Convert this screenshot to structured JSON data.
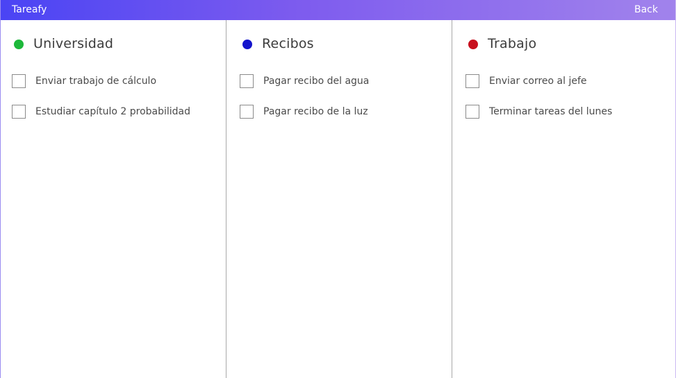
{
  "titlebar": {
    "app_title": "Tareafy",
    "back_label": "Back"
  },
  "categories": [
    {
      "name": "Universidad",
      "color": "#1db83a",
      "tasks": [
        {
          "label": "Enviar trabajo de cálculo",
          "checked": false
        },
        {
          "label": "Estudiar capítulo 2 probabilidad",
          "checked": false
        }
      ]
    },
    {
      "name": "Recibos",
      "color": "#1414cc",
      "tasks": [
        {
          "label": "Pagar recibo del agua",
          "checked": false
        },
        {
          "label": "Pagar recibo de la luz",
          "checked": false
        }
      ]
    },
    {
      "name": "Trabajo",
      "color": "#c8101e",
      "tasks": [
        {
          "label": "Enviar correo al jefe",
          "checked": false
        },
        {
          "label": "Terminar tareas del lunes",
          "checked": false
        }
      ]
    }
  ],
  "colors": {
    "titlebar_start": "#4a44f4",
    "titlebar_end": "#a183ec"
  }
}
